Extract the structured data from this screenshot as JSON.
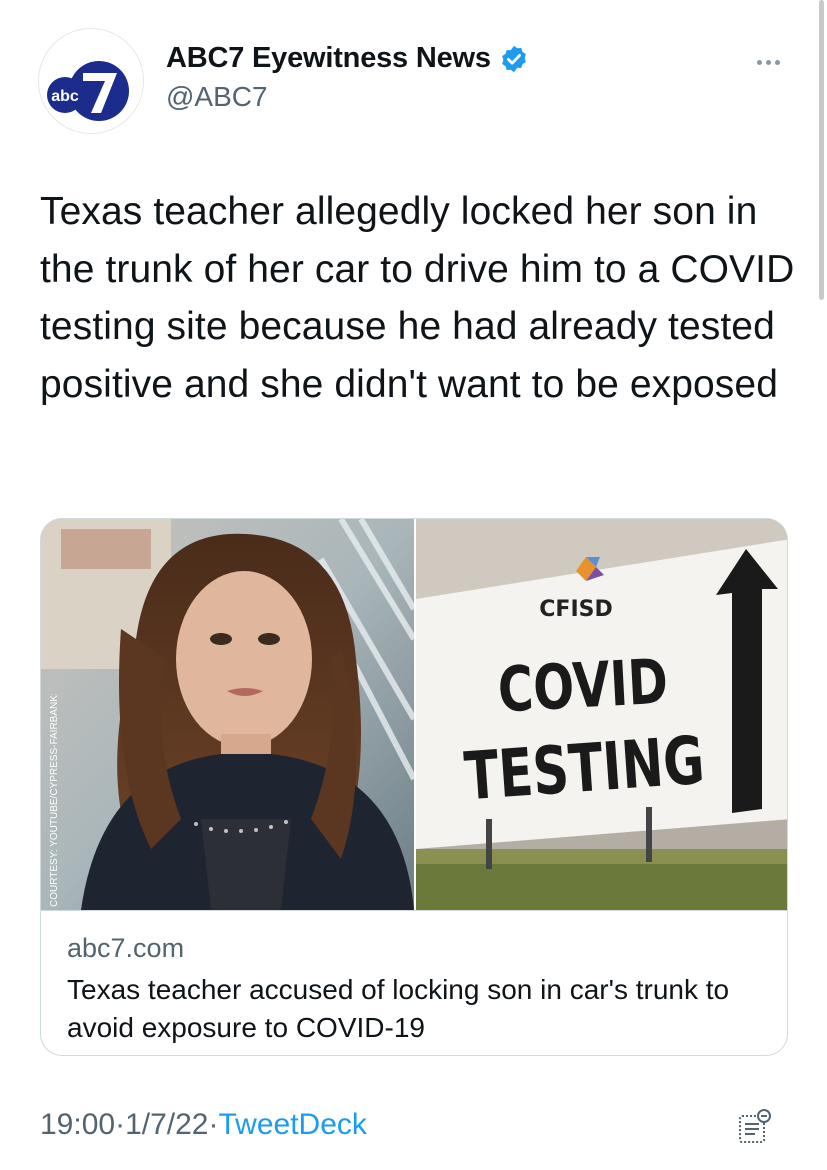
{
  "author": {
    "display_name": "ABC7 Eyewitness News",
    "handle": "@ABC7",
    "verified": true,
    "avatar_logo_text": "abc7",
    "avatar_logo_color": "#1b2c8c"
  },
  "more_icon": "ellipsis-icon",
  "tweet": {
    "text": "Texas teacher allegedly locked her son in the trunk of her car to drive him to a COVID testing site because he had already tested positive and she didn't want to be exposed"
  },
  "card": {
    "domain": "abc7.com",
    "title": "Texas teacher accused of locking son in car's trunk to avoid exposure to COVID-19",
    "image_left_credit": "COURTESY: YOUTUBE/CYPRESS-FAIRBANKS ISD",
    "sign": {
      "org": "CFISD",
      "line1": "COVID",
      "line2": "TESTING"
    }
  },
  "footer": {
    "time": "19:00",
    "sep1": " · ",
    "date": "1/7/22",
    "sep2": " · ",
    "source": "TweetDeck",
    "analytics_icon": "analytics-icon"
  },
  "colors": {
    "link": "#1d9bf0",
    "secondary_text": "#536471",
    "verified_badge": "#1d9bf0",
    "border": "#cfd9de"
  }
}
